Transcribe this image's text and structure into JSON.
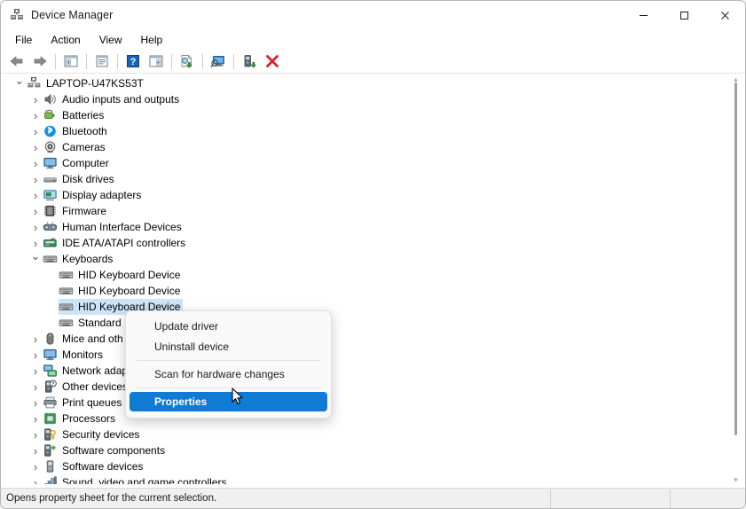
{
  "window": {
    "title": "Device Manager",
    "icon": "device-manager-icon",
    "minimize": "–",
    "maximize": "☐",
    "close": "✕"
  },
  "menubar": [
    {
      "label": "File"
    },
    {
      "label": "Action"
    },
    {
      "label": "View"
    },
    {
      "label": "Help"
    }
  ],
  "toolbar": [
    {
      "name": "back-icon"
    },
    {
      "name": "forward-icon"
    },
    {
      "name": "separator"
    },
    {
      "name": "show-hide-console-tree-icon"
    },
    {
      "name": "separator"
    },
    {
      "name": "properties-icon"
    },
    {
      "name": "separator"
    },
    {
      "name": "help-icon"
    },
    {
      "name": "show-hide-action-pane-icon"
    },
    {
      "name": "separator"
    },
    {
      "name": "update-driver-icon"
    },
    {
      "name": "separator"
    },
    {
      "name": "scan-for-hardware-changes-icon"
    },
    {
      "name": "separator"
    },
    {
      "name": "enable-device-icon"
    },
    {
      "name": "uninstall-device-icon"
    }
  ],
  "tree": [
    {
      "label": "LAPTOP-U47KS53T",
      "indent": 0,
      "state": "open",
      "icon": "computer-root-icon",
      "selected": false
    },
    {
      "label": "Audio inputs and outputs",
      "indent": 1,
      "state": "closed",
      "icon": "speaker-icon",
      "selected": false
    },
    {
      "label": "Batteries",
      "indent": 1,
      "state": "closed",
      "icon": "battery-icon",
      "selected": false
    },
    {
      "label": "Bluetooth",
      "indent": 1,
      "state": "closed",
      "icon": "bluetooth-icon",
      "selected": false
    },
    {
      "label": "Cameras",
      "indent": 1,
      "state": "closed",
      "icon": "camera-icon",
      "selected": false
    },
    {
      "label": "Computer",
      "indent": 1,
      "state": "closed",
      "icon": "monitor-icon",
      "selected": false
    },
    {
      "label": "Disk drives",
      "indent": 1,
      "state": "closed",
      "icon": "disk-drive-icon",
      "selected": false
    },
    {
      "label": "Display adapters",
      "indent": 1,
      "state": "closed",
      "icon": "display-adapter-icon",
      "selected": false
    },
    {
      "label": "Firmware",
      "indent": 1,
      "state": "closed",
      "icon": "firmware-chip-icon",
      "selected": false
    },
    {
      "label": "Human Interface Devices",
      "indent": 1,
      "state": "closed",
      "icon": "hid-icon",
      "selected": false
    },
    {
      "label": "IDE ATA/ATAPI controllers",
      "indent": 1,
      "state": "closed",
      "icon": "ide-controller-icon",
      "selected": false
    },
    {
      "label": "Keyboards",
      "indent": 1,
      "state": "open",
      "icon": "keyboard-icon",
      "selected": false
    },
    {
      "label": "HID Keyboard Device",
      "indent": 2,
      "state": "none",
      "icon": "keyboard-icon",
      "selected": false
    },
    {
      "label": "HID Keyboard Device",
      "indent": 2,
      "state": "none",
      "icon": "keyboard-icon",
      "selected": false
    },
    {
      "label": "HID Keyboard Device",
      "indent": 2,
      "state": "none",
      "icon": "keyboard-icon",
      "selected": true
    },
    {
      "label": "Standard",
      "indent": 2,
      "state": "none",
      "icon": "keyboard-icon",
      "selected": false
    },
    {
      "label": "Mice and oth",
      "indent": 1,
      "state": "closed",
      "icon": "mouse-icon",
      "selected": false
    },
    {
      "label": "Monitors",
      "indent": 1,
      "state": "closed",
      "icon": "monitor-icon",
      "selected": false
    },
    {
      "label": "Network adap",
      "indent": 1,
      "state": "closed",
      "icon": "network-adapter-icon",
      "selected": false
    },
    {
      "label": "Other devices",
      "indent": 1,
      "state": "closed",
      "icon": "unknown-device-icon",
      "selected": false
    },
    {
      "label": "Print queues",
      "indent": 1,
      "state": "closed",
      "icon": "printer-icon",
      "selected": false
    },
    {
      "label": "Processors",
      "indent": 1,
      "state": "closed",
      "icon": "processor-icon",
      "selected": false
    },
    {
      "label": "Security devices",
      "indent": 1,
      "state": "closed",
      "icon": "security-device-icon",
      "selected": false
    },
    {
      "label": "Software components",
      "indent": 1,
      "state": "closed",
      "icon": "software-component-icon",
      "selected": false
    },
    {
      "label": "Software devices",
      "indent": 1,
      "state": "closed",
      "icon": "software-device-icon",
      "selected": false
    },
    {
      "label": "Sound, video and game controllers",
      "indent": 1,
      "state": "closed",
      "icon": "sound-controller-icon",
      "selected": false
    }
  ],
  "context_menu": [
    {
      "label": "Update driver",
      "type": "item",
      "highlighted": false
    },
    {
      "label": "Uninstall device",
      "type": "item",
      "highlighted": false
    },
    {
      "label": "",
      "type": "separator",
      "highlighted": false
    },
    {
      "label": "Scan for hardware changes",
      "type": "item",
      "highlighted": false
    },
    {
      "label": "",
      "type": "separator",
      "highlighted": false
    },
    {
      "label": "Properties",
      "type": "item",
      "highlighted": true
    }
  ],
  "statusbar": {
    "message": "Opens property sheet for the current selection.",
    "panel2": "",
    "panel3": ""
  },
  "colors": {
    "selection_blue": "#cce4f7",
    "menu_highlight": "#0f7bd4",
    "window_bg": "#ffffff",
    "statusbar_bg": "#f0f0f0"
  }
}
